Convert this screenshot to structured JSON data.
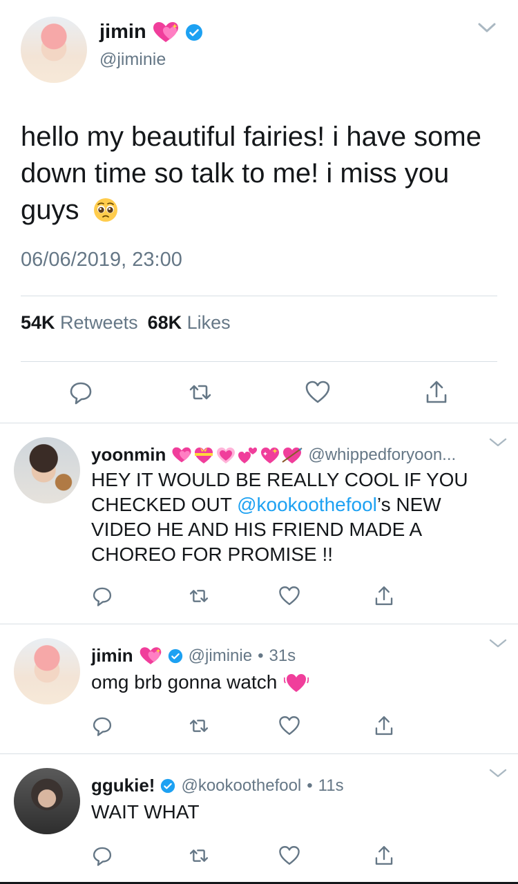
{
  "main_tweet": {
    "name": "jimin",
    "handle": "@jiminie",
    "text": "hello my beautiful fairies! i have some down time so talk to me! i miss you guys",
    "timestamp": "06/06/2019, 23:00",
    "retweets_count": "54K",
    "retweets_label": "Retweets",
    "likes_count": "68K",
    "likes_label": "Likes",
    "name_emoji": "sparkling-heart-icon",
    "text_emoji": "pleading-face-icon",
    "verified": true
  },
  "replies": [
    {
      "name": "yoonmin",
      "handle": "@whippedforyoon...",
      "text_before": "HEY IT WOULD BE REALLY COOL IF YOU CHECKED OUT ",
      "mention": "@kookoothefool",
      "text_after": "’s NEW VIDEO HE AND HIS FRIEND MADE A CHOREO FOR PROMISE !!",
      "verified": false
    },
    {
      "name": "jimin",
      "handle": "@jiminie",
      "dot": "•",
      "time": "31s",
      "text": "omg brb gonna watch",
      "verified": true
    },
    {
      "name": "ggukie!",
      "handle": "@kookoothefool",
      "dot": "•",
      "time": "11s",
      "text": "WAIT WHAT",
      "verified": true
    }
  ],
  "icons": {
    "reply": "reply-icon",
    "retweet": "retweet-icon",
    "like": "heart-icon",
    "share": "share-icon",
    "more": "chevron-down-icon"
  },
  "colors": {
    "text": "#14171a",
    "secondary": "#657786",
    "link": "#1da1f2",
    "divider": "#d8dfe4",
    "verified": "#1da1f2",
    "heart_emoji": "#e8308a"
  }
}
